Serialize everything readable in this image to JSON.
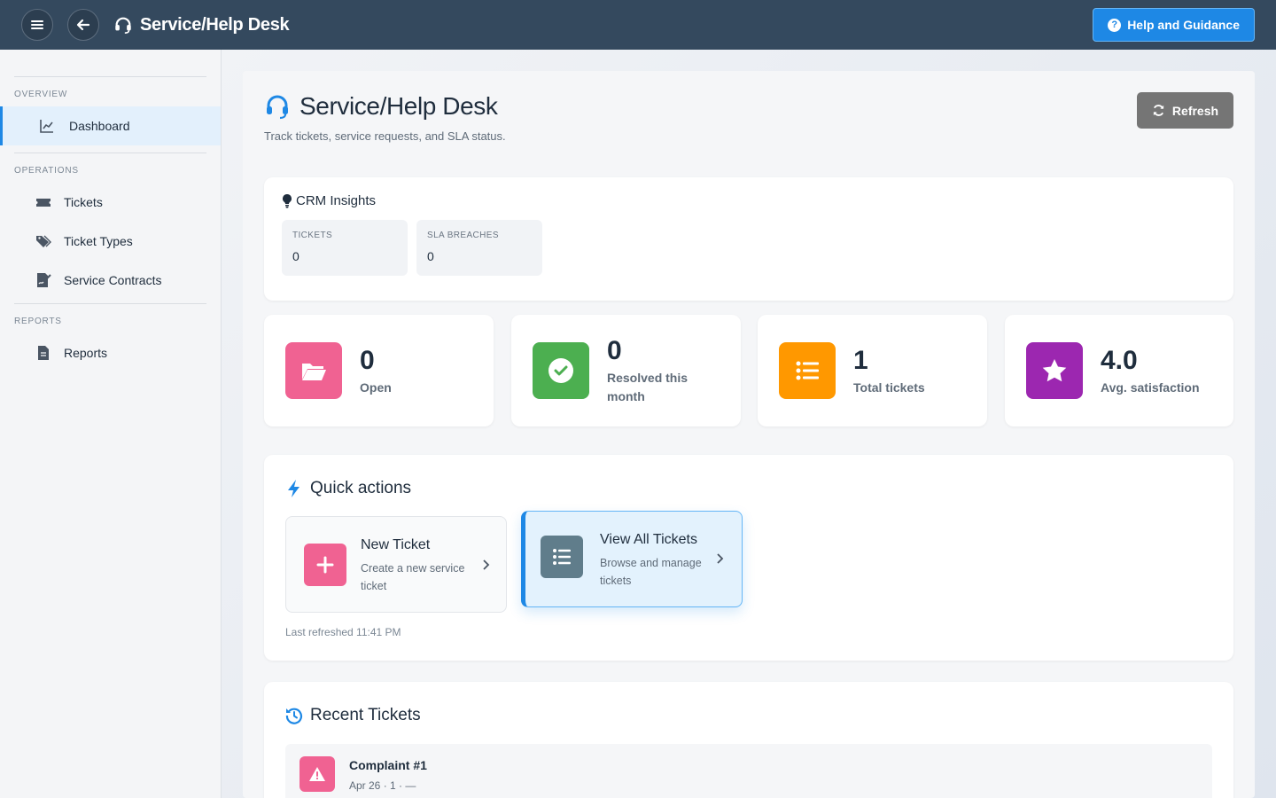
{
  "topbar": {
    "title": "Service/Help Desk",
    "help_label": "Help and Guidance",
    "icons": [
      "menu-icon",
      "back-arrow-icon",
      "headset-icon",
      "question-circle-icon"
    ]
  },
  "sidebar": {
    "sections": [
      {
        "heading": "OVERVIEW",
        "items": [
          {
            "label": "Dashboard",
            "icon": "chart-line-icon",
            "active": true
          }
        ]
      },
      {
        "heading": "OPERATIONS",
        "items": [
          {
            "label": "Tickets",
            "icon": "ticket-icon"
          },
          {
            "label": "Ticket Types",
            "icon": "tags-icon"
          },
          {
            "label": "Service Contracts",
            "icon": "file-signature-icon"
          }
        ]
      },
      {
        "heading": "REPORTS",
        "items": [
          {
            "label": "Reports",
            "icon": "file-icon"
          }
        ]
      }
    ]
  },
  "header": {
    "title": "Service/Help Desk",
    "subtitle": "Track tickets, service requests, and SLA status.",
    "refresh_label": "Refresh"
  },
  "insights": {
    "title": "CRM Insights",
    "metrics": [
      {
        "label": "TICKETS",
        "value": "0"
      },
      {
        "label": "SLA BREACHES",
        "value": "0"
      }
    ]
  },
  "stats": [
    {
      "value": "0",
      "label": "Open",
      "color": "#f06292",
      "icon": "folder-open-icon"
    },
    {
      "value": "0",
      "label": "Resolved this month",
      "color": "#4caf50",
      "icon": "check-circle-icon"
    },
    {
      "value": "1",
      "label": "Total tickets",
      "color": "#ff9800",
      "icon": "list-icon"
    },
    {
      "value": "4.0",
      "label": "Avg. satisfaction",
      "color": "#9c27b0",
      "icon": "star-icon"
    }
  ],
  "quick_actions": {
    "title": "Quick actions",
    "items": [
      {
        "title": "New Ticket",
        "desc": "Create a new service ticket",
        "color": "#f06292",
        "icon": "plus-icon"
      },
      {
        "title": "View All Tickets",
        "desc": "Browse and manage tickets",
        "color": "#607d8b",
        "icon": "list-icon",
        "active": true
      }
    ],
    "last_refreshed": "Last refreshed 11:41 PM"
  },
  "recent": {
    "title": "Recent Tickets",
    "tickets": [
      {
        "title": "Complaint #1",
        "meta": "Apr 26 · 1 · —",
        "color": "#f06292",
        "icon": "warning-icon"
      }
    ]
  },
  "colors": {
    "topbar": "#34495e",
    "accent": "#1e88e5"
  }
}
